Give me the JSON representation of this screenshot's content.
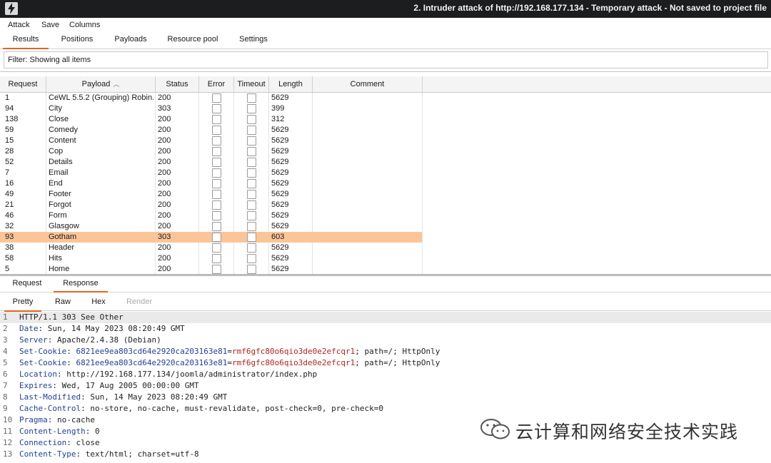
{
  "window": {
    "title": "2. Intruder attack of http://192.168.177.134 - Temporary attack - Not saved to project file",
    "icon": "burp-lightning-icon"
  },
  "menu": [
    "Attack",
    "Save",
    "Columns"
  ],
  "main_tabs": {
    "items": [
      "Results",
      "Positions",
      "Payloads",
      "Resource pool",
      "Settings"
    ],
    "active": "Results"
  },
  "filter": {
    "text": "Filter: Showing all items"
  },
  "table": {
    "columns": [
      "Request",
      "Payload",
      "Status",
      "Error",
      "Timeout",
      "Length",
      "Comment"
    ],
    "sorted_column": "Payload",
    "sort_direction": "ascending",
    "rows": [
      {
        "request": "1",
        "payload": "CeWL 5.5.2 (Grouping) Robin...",
        "status": "200",
        "error": false,
        "timeout": false,
        "length": "5629"
      },
      {
        "request": "94",
        "payload": "City",
        "status": "303",
        "error": false,
        "timeout": false,
        "length": "399"
      },
      {
        "request": "138",
        "payload": "Close",
        "status": "200",
        "error": false,
        "timeout": false,
        "length": "312"
      },
      {
        "request": "59",
        "payload": "Comedy",
        "status": "200",
        "error": false,
        "timeout": false,
        "length": "5629"
      },
      {
        "request": "15",
        "payload": "Content",
        "status": "200",
        "error": false,
        "timeout": false,
        "length": "5629"
      },
      {
        "request": "28",
        "payload": "Cop",
        "status": "200",
        "error": false,
        "timeout": false,
        "length": "5629"
      },
      {
        "request": "52",
        "payload": "Details",
        "status": "200",
        "error": false,
        "timeout": false,
        "length": "5629"
      },
      {
        "request": "7",
        "payload": "Email",
        "status": "200",
        "error": false,
        "timeout": false,
        "length": "5629"
      },
      {
        "request": "16",
        "payload": "End",
        "status": "200",
        "error": false,
        "timeout": false,
        "length": "5629"
      },
      {
        "request": "49",
        "payload": "Footer",
        "status": "200",
        "error": false,
        "timeout": false,
        "length": "5629"
      },
      {
        "request": "21",
        "payload": "Forgot",
        "status": "200",
        "error": false,
        "timeout": false,
        "length": "5629"
      },
      {
        "request": "46",
        "payload": "Form",
        "status": "200",
        "error": false,
        "timeout": false,
        "length": "5629"
      },
      {
        "request": "32",
        "payload": "Glasgow",
        "status": "200",
        "error": false,
        "timeout": false,
        "length": "5629"
      },
      {
        "request": "93",
        "payload": "Gotham",
        "status": "303",
        "error": false,
        "timeout": false,
        "length": "603",
        "selected": true
      },
      {
        "request": "38",
        "payload": "Header",
        "status": "200",
        "error": false,
        "timeout": false,
        "length": "5629"
      },
      {
        "request": "58",
        "payload": "Hits",
        "status": "200",
        "error": false,
        "timeout": false,
        "length": "5629"
      },
      {
        "request": "5",
        "payload": "Home",
        "status": "200",
        "error": false,
        "timeout": false,
        "length": "5629"
      }
    ],
    "selected_row_color": "#fbc59a"
  },
  "message_tabs": {
    "items": [
      "Request",
      "Response"
    ],
    "active": "Response"
  },
  "view_tabs": {
    "items": [
      "Pretty",
      "Raw",
      "Hex",
      "Render"
    ],
    "active": "Pretty",
    "disabled": [
      "Render"
    ]
  },
  "response_lines": [
    {
      "n": "1",
      "text": "HTTP/1.1 303 See Other"
    },
    {
      "n": "2",
      "key": "Date",
      "value": " Sun, 14 May 2023 08:20:49 GMT"
    },
    {
      "n": "3",
      "key": "Server",
      "value": " Apache/2.4.38 (Debian)"
    },
    {
      "n": "4",
      "key": "Set-Cookie",
      "cookie_name": " 6821ee9ea803cd64e2920ca203163e81",
      "cookie_value": "rmf6gfc80o6qio3de0e2efcqr1",
      "rest": "; path=/; HttpOnly"
    },
    {
      "n": "5",
      "key": "Set-Cookie",
      "cookie_name": " 6821ee9ea803cd64e2920ca203163e81",
      "cookie_value": "rmf6gfc80o6qio3de0e2efcqr1",
      "rest": "; path=/; HttpOnly"
    },
    {
      "n": "6",
      "key": "Location",
      "value": " http://192.168.177.134/joomla/administrator/index.php"
    },
    {
      "n": "7",
      "key": "Expires",
      "value": " Wed, 17 Aug 2005 00:00:00 GMT"
    },
    {
      "n": "8",
      "key": "Last-Modified",
      "value": " Sun, 14 May 2023 08:20:49 GMT"
    },
    {
      "n": "9",
      "key": "Cache-Control",
      "value": " no-store, no-cache, must-revalidate, post-check=0, pre-check=0"
    },
    {
      "n": "10",
      "key": "Pragma",
      "value": " no-cache"
    },
    {
      "n": "11",
      "key": "Content-Length",
      "value": " 0"
    },
    {
      "n": "12",
      "key": "Connection",
      "value": " close"
    },
    {
      "n": "13",
      "key": "Content-Type",
      "value": " text/html; charset=utf-8"
    }
  ],
  "watermark": {
    "text": "云计算和网络安全技术实践",
    "icon": "wechat-icon"
  },
  "colors": {
    "accent": "#e8631d",
    "titlebar": "#1b1d1f",
    "header_key": "#1f3f9e",
    "cookie_value": "#b3261e"
  }
}
